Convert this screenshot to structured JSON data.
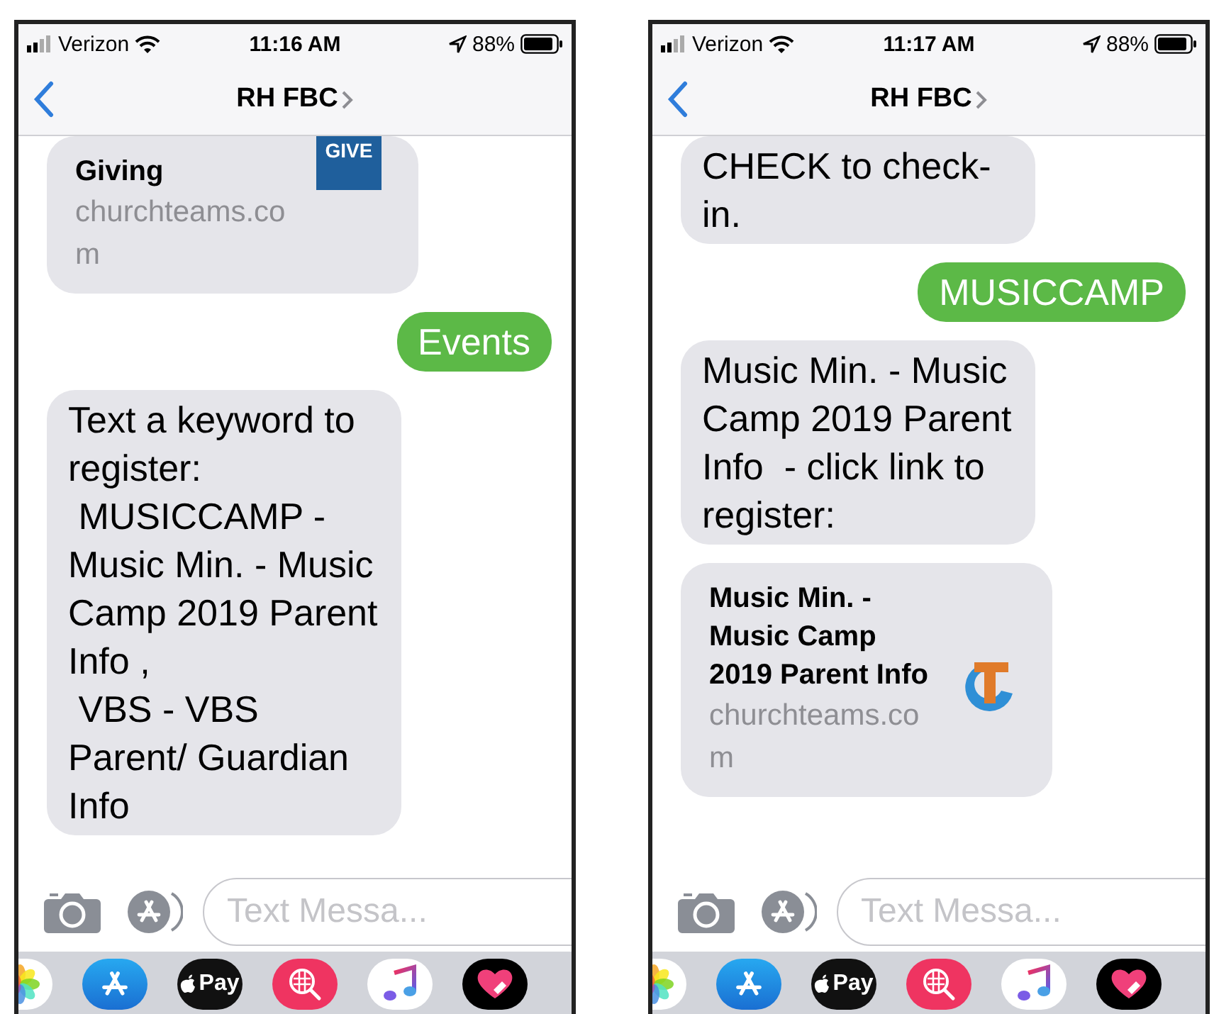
{
  "phones": [
    {
      "status_bar": {
        "carrier": "Verizon",
        "time": "11:16 AM",
        "battery": "88%"
      },
      "conversation": {
        "title": "RH FBC"
      },
      "messages": [
        {
          "kind": "link",
          "sent": false,
          "title": "Giving",
          "domain": "churchteams.com",
          "logo": {
            "kind": "give",
            "text": "GIVE"
          }
        },
        {
          "kind": "text",
          "sent": true,
          "text": "Events"
        },
        {
          "kind": "text",
          "sent": false,
          "text": "Text a keyword to register:\n MUSICCAMP - Music Min. - Music Camp 2019 Parent Info ,\n VBS - VBS Parent/ Guardian Info"
        }
      ],
      "composer": {
        "placeholder": "Text Messa..."
      },
      "app_drawer": [
        {
          "kind": "photos"
        },
        {
          "kind": "store"
        },
        {
          "kind": "pay",
          "label": "Pay"
        },
        {
          "kind": "search"
        },
        {
          "kind": "music"
        },
        {
          "kind": "heart"
        }
      ]
    },
    {
      "status_bar": {
        "carrier": "Verizon",
        "time": "11:17 AM",
        "battery": "88%"
      },
      "conversation": {
        "title": "RH FBC"
      },
      "messages": [
        {
          "kind": "text",
          "sent": false,
          "text": "CHECK to check-in."
        },
        {
          "kind": "text",
          "sent": true,
          "text": "MUSICCAMP"
        },
        {
          "kind": "text",
          "sent": false,
          "text": "Music Min. - Music Camp 2019 Parent Info  - click link to register:"
        },
        {
          "kind": "link",
          "sent": false,
          "title": "Music Min. - Music Camp 2019 Parent Info",
          "domain": "churchteams.com",
          "logo": {
            "kind": "ct"
          }
        }
      ],
      "composer": {
        "placeholder": "Text Messa..."
      },
      "app_drawer": [
        {
          "kind": "photos"
        },
        {
          "kind": "store"
        },
        {
          "kind": "pay",
          "label": "Pay"
        },
        {
          "kind": "search"
        },
        {
          "kind": "music"
        },
        {
          "kind": "heart"
        }
      ]
    }
  ]
}
